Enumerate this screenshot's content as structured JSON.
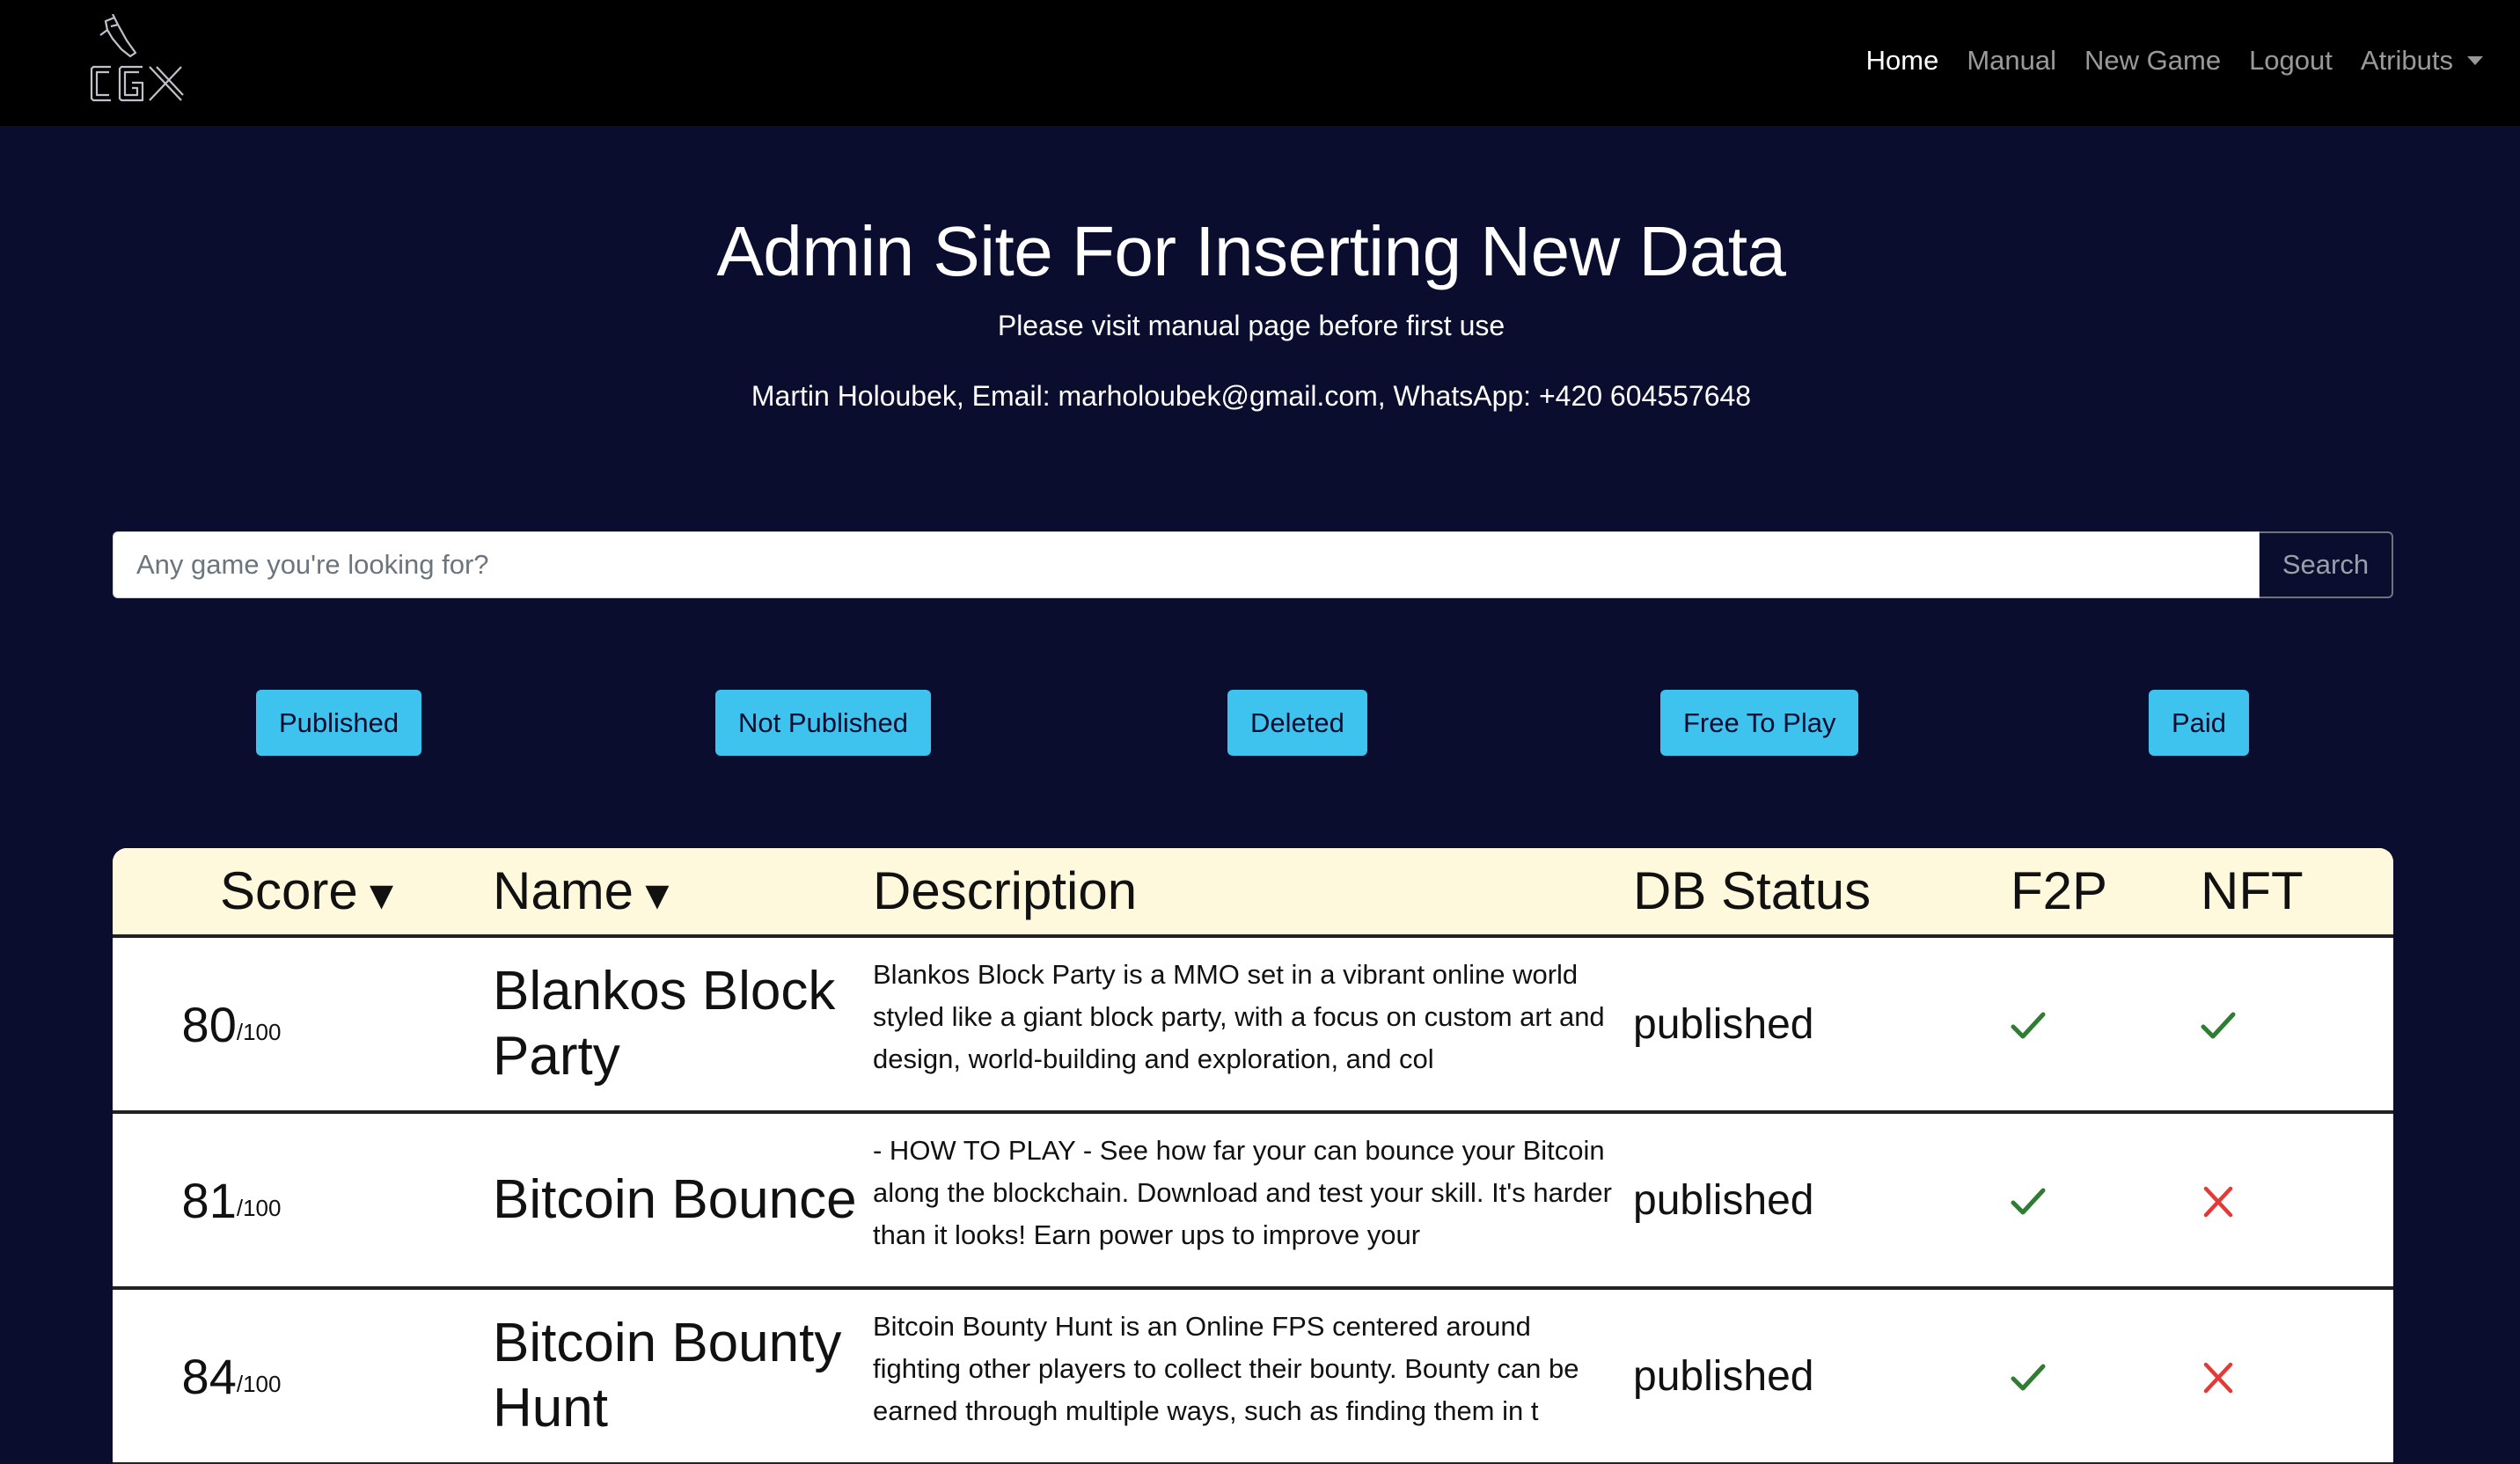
{
  "nav": {
    "logo_text": "CGX",
    "links": [
      "Home",
      "Manual",
      "New Game",
      "Logout"
    ],
    "dropdown_label": "Atributs"
  },
  "hero": {
    "title": "Admin Site For Inserting New Data",
    "subtitle": "Please visit manual page before first use",
    "contact": "Martin Holoubek, Email: marholoubek@gmail.com, WhatsApp: +420 604557648"
  },
  "search": {
    "placeholder": "Any game you're looking for?",
    "button_label": "Search"
  },
  "filters": [
    "Published",
    "Not Published",
    "Deleted",
    "Free To Play",
    "Paid"
  ],
  "table": {
    "headers": {
      "score": "Score",
      "name": "Name",
      "description": "Description",
      "db_status": "DB Status",
      "f2p": "F2P",
      "nft": "NFT"
    },
    "sort_arrow": "▼",
    "score_suffix": "/100",
    "rows": [
      {
        "score": "80",
        "name": "Blankos Block Party",
        "description": "Blankos Block Party is a MMO set in a vibrant online world styled like a giant block party, with a focus on custom art and design, world-building and exploration, and col",
        "status": "published",
        "f2p": true,
        "nft": true
      },
      {
        "score": "81",
        "name": "Bitcoin Bounce",
        "description": "- HOW TO PLAY - See how far your can bounce your Bitcoin along the blockchain. Download and test your skill. It's harder than it looks! Earn power ups to improve your",
        "status": "published",
        "f2p": true,
        "nft": false
      },
      {
        "score": "84",
        "name": "Bitcoin Bounty Hunt",
        "description": "Bitcoin Bounty Hunt is an Online FPS centered around fighting other players to collect their bounty. Bounty can be earned through multiple ways, such as finding them in t",
        "status": "published",
        "f2p": true,
        "nft": false
      }
    ]
  },
  "colors": {
    "background": "#0b0d2e",
    "navbar": "#000000",
    "filter_button": "#3dc3ee",
    "table_header": "#fef8dc",
    "check": "#2e7d32",
    "cross": "#e53935"
  },
  "icons": {
    "yes": "check-icon",
    "no": "close-icon"
  }
}
